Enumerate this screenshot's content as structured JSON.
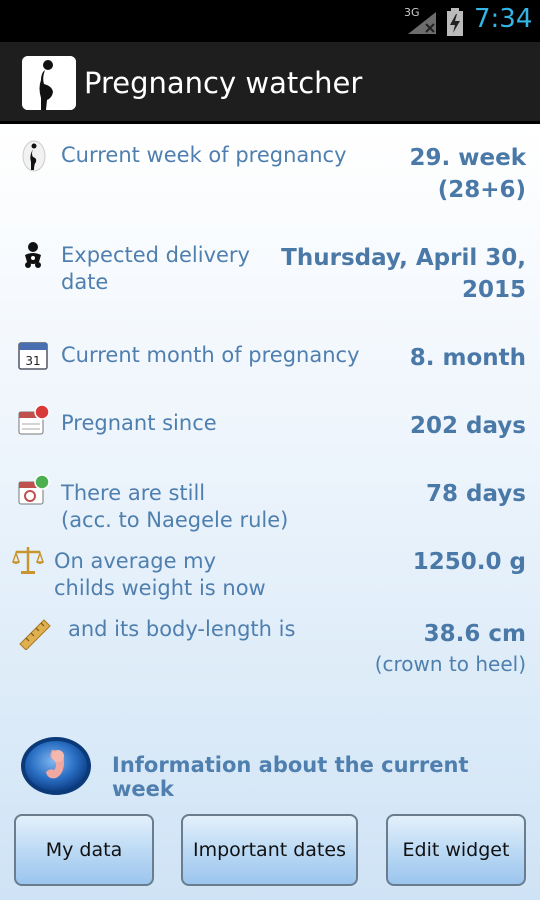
{
  "status_bar": {
    "network": "3G",
    "time": "7:34",
    "time_color": "#33b5e5"
  },
  "action_bar": {
    "title": "Pregnancy watcher",
    "icon": "pregnant-silhouette-icon"
  },
  "rows": [
    {
      "icon": "pregnant-figure-icon",
      "label_lines": [
        "Current week of pregnancy"
      ],
      "value_lines": [
        "29. week",
        "(28+6)"
      ]
    },
    {
      "icon": "baby-icon",
      "label_lines": [
        "Expected delivery",
        "date"
      ],
      "value_lines": [
        "Thursday, April 30,",
        "2015"
      ]
    },
    {
      "icon": "calendar-icon",
      "label_lines": [
        "Current month of pregnancy"
      ],
      "value_lines": [
        "8. month"
      ]
    },
    {
      "icon": "calendar-badge-red-icon",
      "label_lines": [
        "Pregnant since"
      ],
      "value_lines": [
        "202 days"
      ]
    },
    {
      "icon": "calendar-badge-green-icon",
      "label_lines": [
        "There are still",
        "(acc. to Naegele rule)"
      ],
      "value_lines": [
        "78 days"
      ]
    },
    {
      "icon": "scale-icon",
      "label_lines": [
        "On average my",
        "childs weight is now"
      ],
      "value_lines": [
        "1250.0 g"
      ]
    },
    {
      "icon": "ruler-icon",
      "label_lines": [
        "and its body-length is"
      ],
      "value_lines": [
        "38.6 cm"
      ],
      "sub": "(crown to heel)"
    }
  ],
  "info_link": {
    "icon": "fetus-globe-icon",
    "label": "Information about the current week"
  },
  "buttons": {
    "my_data": "My data",
    "important_dates": "Important dates",
    "edit_widget": "Edit widget"
  },
  "colors": {
    "accent_text": "#4f7fae",
    "value_text": "#4a79a8",
    "button_fill": "#b9d8f4"
  }
}
